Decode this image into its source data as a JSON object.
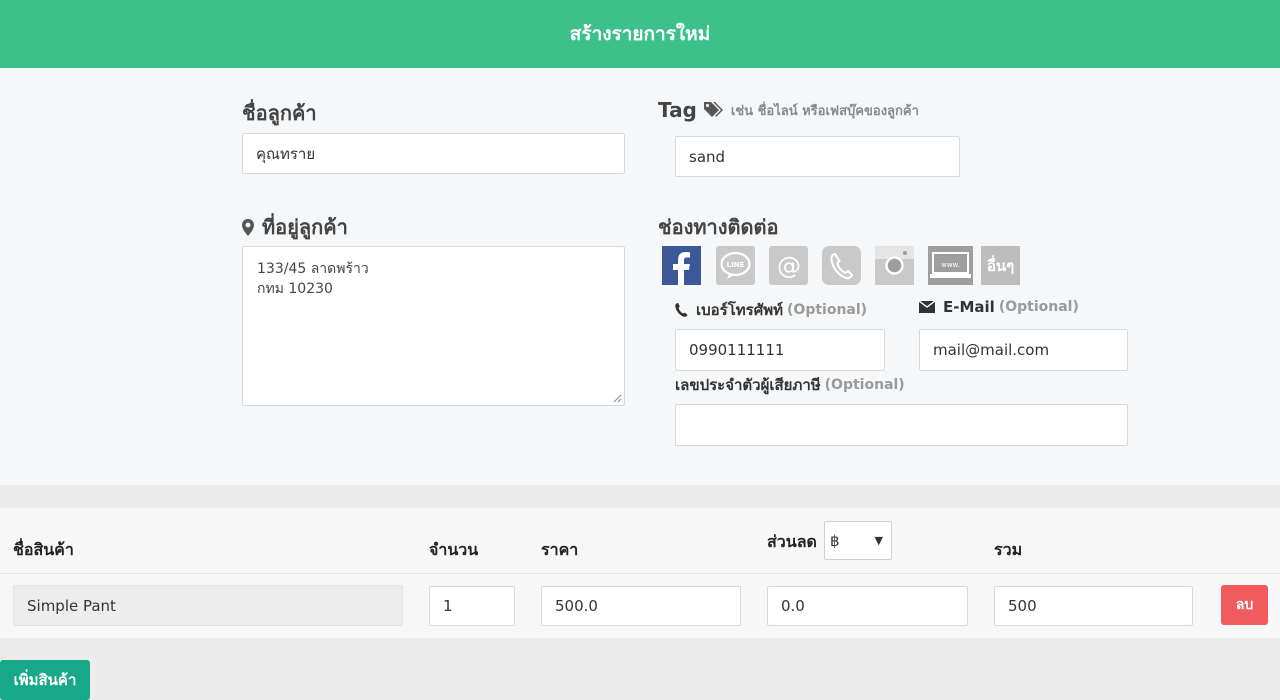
{
  "header": {
    "title": "สร้างรายการใหม่"
  },
  "customer": {
    "name_label": "ชื่อลูกค้า",
    "name_value": "คุณทราย",
    "address_label": "ที่อยู่ลูกค้า",
    "address_lines": [
      "133/45 ลาดพร้าว",
      "กทม 10230"
    ]
  },
  "tag": {
    "label": "Tag",
    "hint": "เช่น ชื่อไลน์ หรือเฟสบุ๊คของลูกค้า",
    "value": "sand"
  },
  "contact": {
    "label": "ช่องทางติดต่อ",
    "channels": [
      "facebook",
      "line",
      "email",
      "phone",
      "instagram",
      "website",
      "other"
    ],
    "other_label": "อื่นๆ",
    "phone_label": "เบอร์โทรศัพท์",
    "phone_optional": "(Optional)",
    "phone_value": "0990111111",
    "email_label": "E-Mail",
    "email_optional": "(Optional)",
    "email_value": "mail@mail.com",
    "taxid_label": "เลขประจำตัวผู้เสียภาษี",
    "taxid_optional": "(Optional)",
    "taxid_value": ""
  },
  "items": {
    "headers": {
      "name": "ชื่อสินค้า",
      "qty": "จำนวน",
      "price": "ราคา",
      "discount": "ส่วนลด",
      "total": "รวม"
    },
    "discount_unit": "฿",
    "row": {
      "name": "Simple Pant",
      "qty": "1",
      "price": "500.0",
      "discount": "0.0",
      "total": "500"
    },
    "delete_label": "ลบ"
  },
  "add_product_label": "เพิ่มสินค้า",
  "colors": {
    "header": "#3cc18b",
    "delete": "#f15b5d",
    "add": "#17a889",
    "facebook": "#3b5998"
  }
}
